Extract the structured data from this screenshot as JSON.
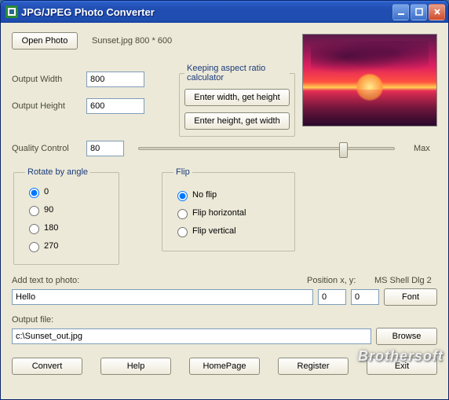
{
  "titlebar": {
    "title": "JPG/JPEG Photo Converter"
  },
  "open_photo": "Open Photo",
  "loaded_info": "Sunset.jpg 800 * 600",
  "labels": {
    "output_width": "Output Width",
    "output_height": "Output Height",
    "quality_control": "Quality Control",
    "max": "Max",
    "add_text": "Add text to photo:",
    "position": "Position x, y:",
    "font_name": "MS Shell Dlg 2",
    "output_file": "Output file:"
  },
  "values": {
    "width": "800",
    "height": "600",
    "quality": "80",
    "add_text": "Hello",
    "pos_x": "0",
    "pos_y": "0",
    "output_path": "c:\\Sunset_out.jpg",
    "slider_percent": 80
  },
  "aspect": {
    "legend": "Keeping aspect ratio calculator",
    "btn_w": "Enter width, get height",
    "btn_h": "Enter height, get width"
  },
  "rotate": {
    "legend": "Rotate by angle",
    "options": [
      "0",
      "90",
      "180",
      "270"
    ],
    "selected": "0"
  },
  "flip": {
    "legend": "Flip",
    "options": [
      "No flip",
      "Flip horizontal",
      "Flip vertical"
    ],
    "selected": "No flip"
  },
  "buttons": {
    "font": "Font",
    "browse": "Browse",
    "convert": "Convert",
    "help": "Help",
    "homepage": "HomePage",
    "register": "Register",
    "exit": "Exit"
  },
  "watermark": "Brothersoft"
}
